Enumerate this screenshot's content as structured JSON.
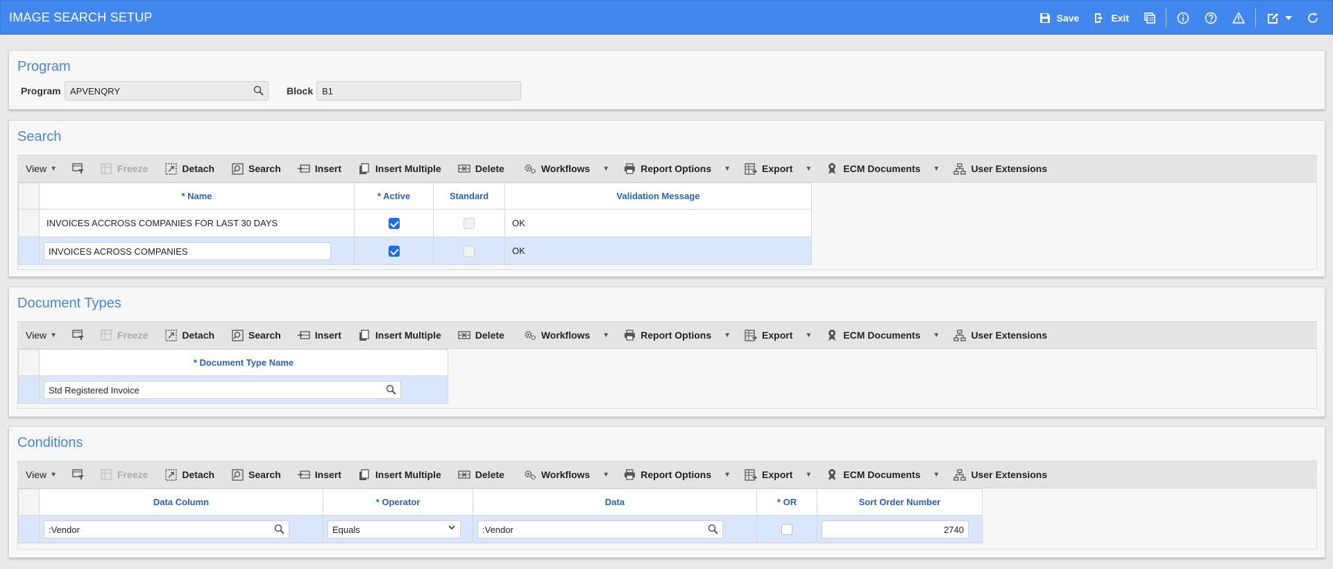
{
  "app": {
    "title": "IMAGE SEARCH SETUP"
  },
  "header_actions": {
    "save": "Save",
    "exit": "Exit"
  },
  "program_panel": {
    "title": "Program",
    "program_label": "Program",
    "program_value": "APVENQRY",
    "block_label": "Block",
    "block_value": "B1"
  },
  "toolbar": {
    "view": "View",
    "freeze": "Freeze",
    "detach": "Detach",
    "search": "Search",
    "insert": "Insert",
    "insert_multiple": "Insert Multiple",
    "delete": "Delete",
    "workflows": "Workflows",
    "report_options": "Report Options",
    "export": "Export",
    "ecm_documents": "ECM Documents",
    "user_extensions": "User Extensions"
  },
  "search_panel": {
    "title": "Search",
    "columns": {
      "name": "* Name",
      "active": "* Active",
      "standard": "Standard",
      "validation": "Validation Message"
    },
    "rows": [
      {
        "name": "INVOICES ACCROSS COMPANIES FOR LAST 30 DAYS",
        "active": true,
        "standard": false,
        "validation": "OK"
      },
      {
        "name": "INVOICES ACROSS COMPANIES",
        "active": true,
        "standard": false,
        "validation": "OK"
      }
    ]
  },
  "doctypes_panel": {
    "title": "Document Types",
    "columns": {
      "doc_type_name": "* Document Type Name"
    },
    "rows": [
      {
        "doc_type_name": "Std Registered Invoice"
      }
    ]
  },
  "conditions_panel": {
    "title": "Conditions",
    "columns": {
      "data_column": "Data Column",
      "operator": "* Operator",
      "data": "Data",
      "or": "* OR",
      "sort_order": "Sort Order Number"
    },
    "rows": [
      {
        "data_column": ":Vendor",
        "operator": "Equals",
        "data": ":Vendor",
        "or": false,
        "sort_order": "2740"
      }
    ]
  }
}
